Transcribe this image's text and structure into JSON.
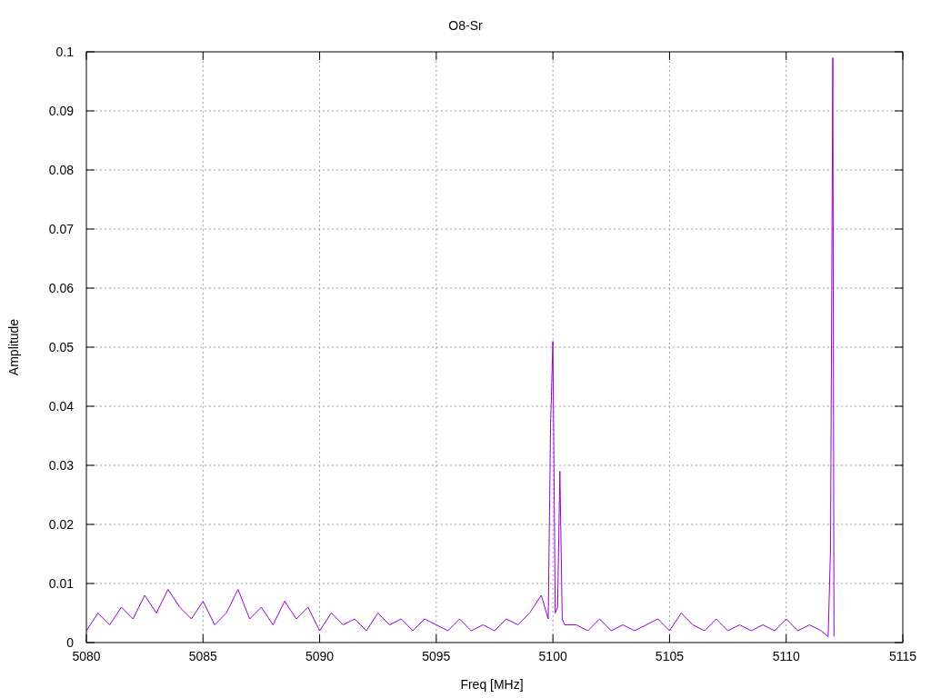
{
  "chart_data": {
    "type": "line",
    "title": "O8-Sr",
    "xlabel": "Freq [MHz]",
    "ylabel": "Amplitude",
    "grid": true,
    "xlim": [
      5080,
      5115
    ],
    "ylim": [
      0,
      0.1
    ],
    "xticks": [
      5080,
      5085,
      5090,
      5095,
      5100,
      5105,
      5110,
      5115
    ],
    "yticks": [
      0,
      0.01,
      0.02,
      0.03,
      0.04,
      0.05,
      0.06,
      0.07,
      0.08,
      0.09,
      0.1
    ],
    "x": [
      5080,
      5080.5,
      5081,
      5081.5,
      5082,
      5082.5,
      5083,
      5083.5,
      5084,
      5084.5,
      5085,
      5085.5,
      5086,
      5086.5,
      5087,
      5087.5,
      5088,
      5088.5,
      5089,
      5089.5,
      5090,
      5090.5,
      5091,
      5091.5,
      5092,
      5092.5,
      5093,
      5093.5,
      5094,
      5094.5,
      5095,
      5095.5,
      5096,
      5096.5,
      5097,
      5097.5,
      5098,
      5098.5,
      5099,
      5099.5,
      5099.8,
      5099.9,
      5100,
      5100.1,
      5100.2,
      5100.3,
      5100.4,
      5100.5,
      5101,
      5101.5,
      5102,
      5102.5,
      5103,
      5103.5,
      5104,
      5104.5,
      5105,
      5105.5,
      5106,
      5106.5,
      5107,
      5107.5,
      5108,
      5108.5,
      5109,
      5109.5,
      5110,
      5110.5,
      5111,
      5111.5,
      5111.8,
      5111.9,
      5112,
      5112.05
    ],
    "series": [
      {
        "color": "#9400d3",
        "values": [
          0.002,
          0.005,
          0.003,
          0.006,
          0.004,
          0.008,
          0.005,
          0.009,
          0.006,
          0.004,
          0.007,
          0.003,
          0.005,
          0.009,
          0.004,
          0.006,
          0.003,
          0.007,
          0.004,
          0.006,
          0.002,
          0.005,
          0.003,
          0.004,
          0.002,
          0.005,
          0.003,
          0.004,
          0.002,
          0.004,
          0.003,
          0.002,
          0.004,
          0.002,
          0.003,
          0.002,
          0.004,
          0.003,
          0.005,
          0.008,
          0.004,
          0.037,
          0.051,
          0.005,
          0.006,
          0.029,
          0.004,
          0.003,
          0.003,
          0.002,
          0.004,
          0.002,
          0.003,
          0.002,
          0.003,
          0.004,
          0.002,
          0.005,
          0.003,
          0.002,
          0.004,
          0.002,
          0.003,
          0.002,
          0.003,
          0.002,
          0.004,
          0.002,
          0.003,
          0.002,
          0.001,
          0.016,
          0.099,
          0.001
        ]
      }
    ]
  }
}
